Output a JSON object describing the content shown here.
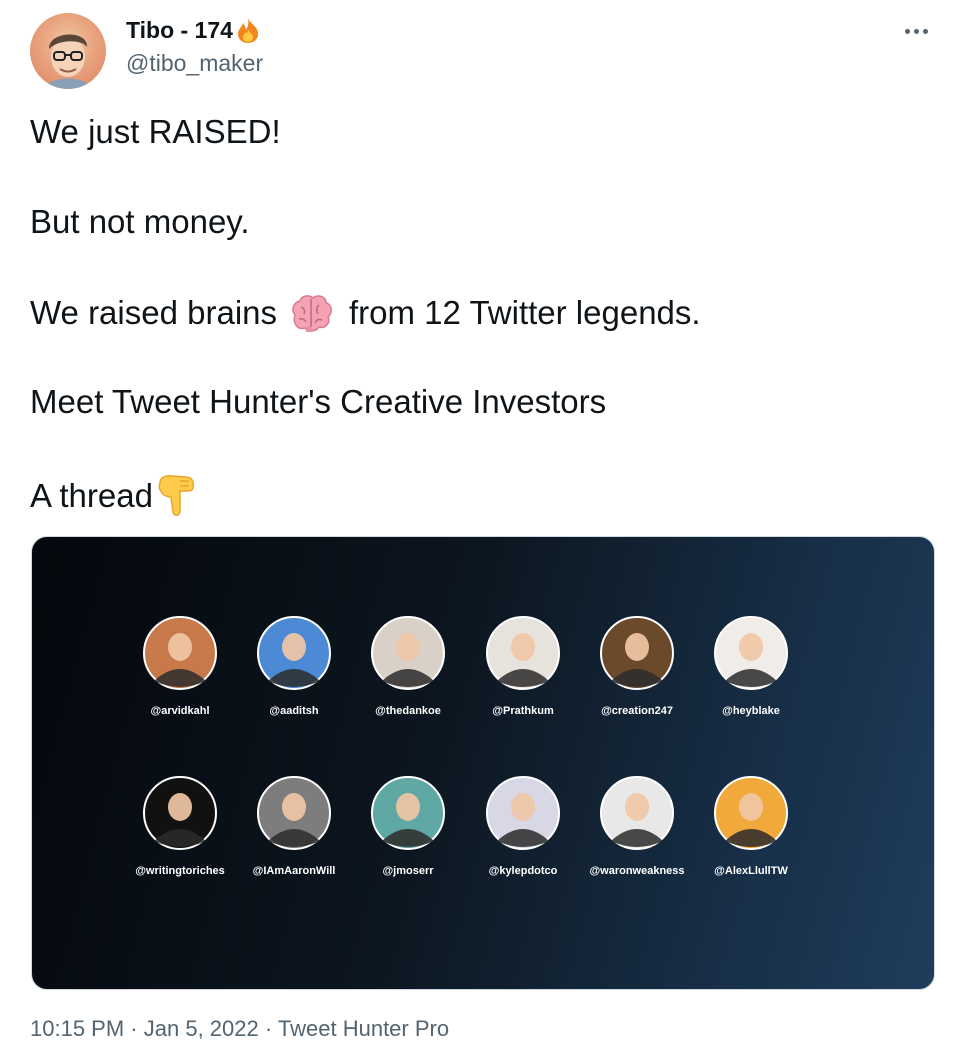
{
  "author": {
    "name": "Tibo - 174",
    "handle": "@tibo_maker"
  },
  "tweet_lines": [
    "We just RAISED!",
    "But not money.",
    "We raised brains",
    "from 12 Twitter legends.",
    "Meet Tweet Hunter's Creative Investors",
    "A thread"
  ],
  "icons": {
    "streak": "fire-icon",
    "line3": "brain-icon",
    "line5": "backhand-index-pointing-down-icon",
    "menu": "more-horizontal-icon"
  },
  "media": {
    "investors": [
      {
        "handle": "@arvidkahl",
        "color": "#c8794a"
      },
      {
        "handle": "@aaditsh",
        "color": "#4c8ad6"
      },
      {
        "handle": "@thedankoe",
        "color": "#d9d1c8"
      },
      {
        "handle": "@Prathkum",
        "color": "#e6e2dc"
      },
      {
        "handle": "@creation247",
        "color": "#6b4a2c"
      },
      {
        "handle": "@heyblake",
        "color": "#f0ece8"
      },
      {
        "handle": "@writingtoriches",
        "color": "#111111"
      },
      {
        "handle": "@IAmAaronWill",
        "color": "#7d7d7d"
      },
      {
        "handle": "@jmoserr",
        "color": "#5fa8a3"
      },
      {
        "handle": "@kylepdotco",
        "color": "#d7d7e6"
      },
      {
        "handle": "@waronweakness",
        "color": "#e8e8e8"
      },
      {
        "handle": "@AlexLlullTW",
        "color": "#f2a93b"
      }
    ]
  },
  "meta": {
    "time": "10:15 PM",
    "separator": "·",
    "date": "Jan 5, 2022",
    "source": "Tweet Hunter Pro"
  },
  "colors": {
    "text": "#0f1419",
    "secondary": "#536471",
    "media_dark": "#05080d",
    "media_light": "#1f3d5b"
  }
}
